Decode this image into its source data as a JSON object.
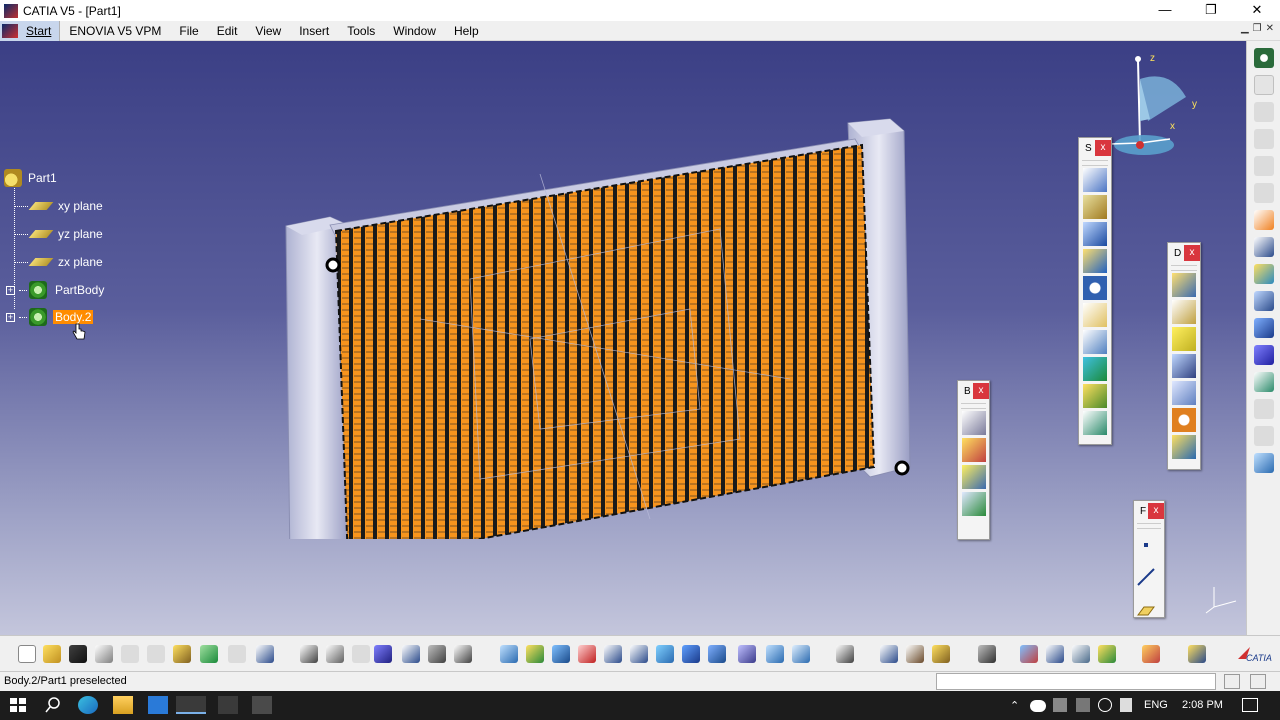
{
  "window": {
    "title": "CATIA V5 - [Part1]",
    "minimize_glyph": "—",
    "maximize_glyph": "❐",
    "close_glyph": "✕"
  },
  "menu": {
    "start": "Start",
    "items": [
      "ENOVIA V5 VPM",
      "File",
      "Edit",
      "View",
      "Insert",
      "Tools",
      "Window",
      "Help"
    ]
  },
  "tree": {
    "root": "Part1",
    "items": [
      {
        "label": "xy plane",
        "icon": "plane-icon"
      },
      {
        "label": "yz plane",
        "icon": "plane-icon"
      },
      {
        "label": "zx plane",
        "icon": "plane-icon"
      },
      {
        "label": "PartBody",
        "icon": "body-icon",
        "expandable": true
      },
      {
        "label": "Body.2",
        "icon": "body-icon",
        "expandable": true,
        "selected": true
      }
    ]
  },
  "compass": {
    "labels": [
      "z",
      "y",
      "x"
    ]
  },
  "floating_toolbars": [
    {
      "title": "S",
      "close": "x"
    },
    {
      "title": "D",
      "close": "x"
    },
    {
      "title": "B",
      "close": "x"
    },
    {
      "title": "F",
      "close": "x"
    }
  ],
  "status": {
    "message": "Body.2/Part1 preselected"
  },
  "taskbar": {
    "language": "ENG",
    "time": "2:08 PM"
  },
  "colors": {
    "viewport_top": "#3b3f85",
    "viewport_bottom": "#c4c6dc",
    "selection": "#ff8c00",
    "close_button": "#d9363e"
  }
}
